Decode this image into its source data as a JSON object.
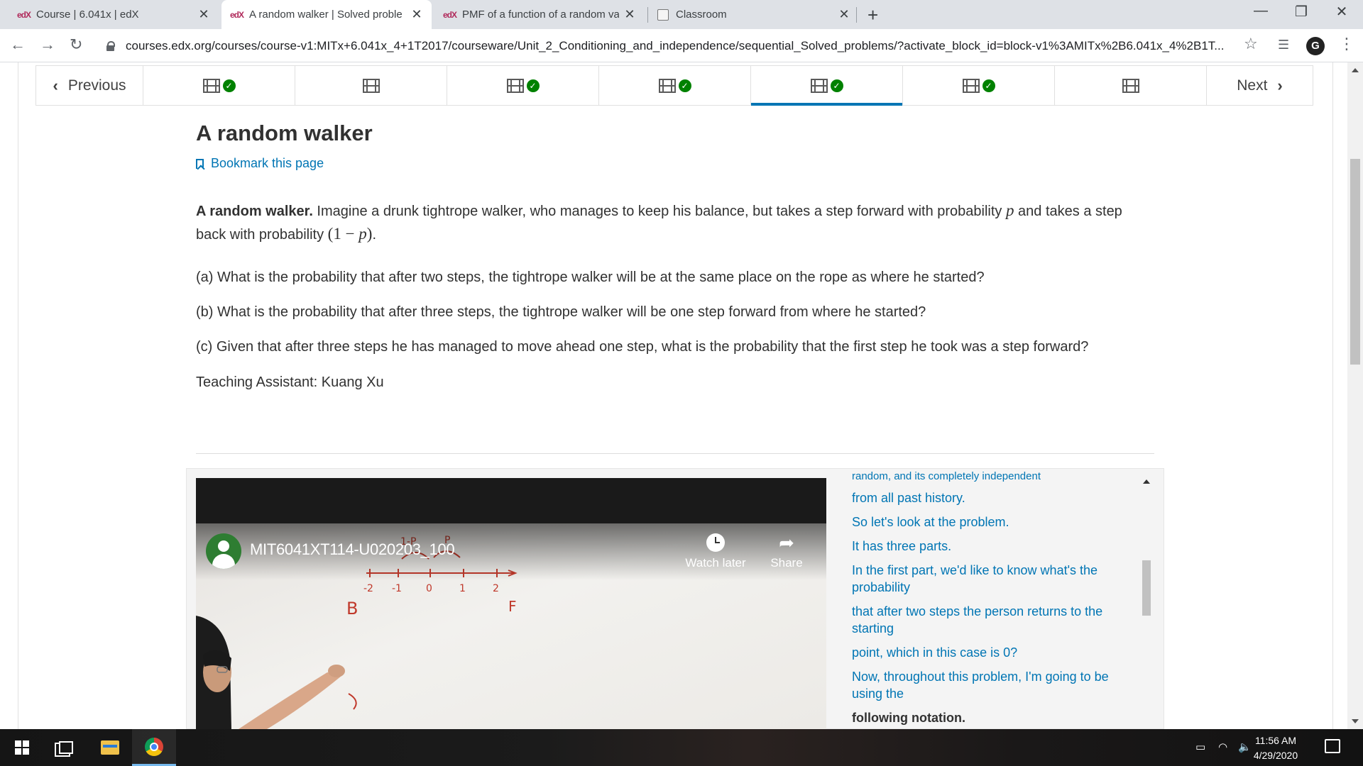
{
  "browser": {
    "tabs": [
      {
        "favicon": "edX",
        "title": "Course | 6.041x | edX",
        "active": false
      },
      {
        "favicon": "edX",
        "title": "A random walker | Solved proble",
        "active": true
      },
      {
        "favicon": "edX",
        "title": "PMF of a function of a random va",
        "active": false
      },
      {
        "favicon": "classroom-icon",
        "title": "Classroom",
        "active": false
      }
    ],
    "url": "courses.edx.org/courses/course-v1:MITx+6.041x_4+1T2017/courseware/Unit_2_Conditioning_and_independence/sequential_Solved_problems/?activate_block_id=block-v1%3AMITx%2B6.041x_4%2B1T..."
  },
  "sequence_nav": {
    "previous_label": "Previous",
    "next_label": "Next",
    "items": [
      {
        "type": "video",
        "completed": true,
        "active": false
      },
      {
        "type": "video",
        "completed": false,
        "active": false
      },
      {
        "type": "video",
        "completed": true,
        "active": false
      },
      {
        "type": "video",
        "completed": true,
        "active": false
      },
      {
        "type": "video",
        "completed": true,
        "active": true
      },
      {
        "type": "video",
        "completed": true,
        "active": false
      },
      {
        "type": "video",
        "completed": false,
        "active": false
      }
    ]
  },
  "unit": {
    "title": "A random walker",
    "bookmark_label": "Bookmark this page",
    "intro_bold": "A random walker.",
    "intro_text_1": " Imagine a drunk tightrope walker, who manages to keep his balance, but takes a step forward with probability ",
    "intro_text_2": " and takes a step back with probability ",
    "intro_text_3": ".",
    "question_a": "(a) What is the probability that after two steps, the tightrope walker will be at the same place on the rope as where he started?",
    "question_b": "(b) What is the probability that after three steps, the tightrope walker will be one step forward from where he started?",
    "question_c": "(c) Given that after three steps he has managed to move ahead one step, what is the probability that the first step he took was a step forward?",
    "ta": "Teaching Assistant: Kuang Xu"
  },
  "video": {
    "title": "MIT6041XT114-U020203_100",
    "watch_later_label": "Watch later",
    "share_label": "Share"
  },
  "transcript": {
    "partial_line": "random, and its completely independent",
    "lines": [
      "from all past history.",
      "So let's look at the problem.",
      "It has three parts.",
      "In the first part, we'd like to know what's the probability",
      "that after two steps the person returns to the starting",
      "point, which in this case is 0?",
      "Now, throughout this problem, I'm going to be using the"
    ],
    "current_line": "following notation."
  },
  "taskbar": {
    "time": "11:56 AM",
    "date": "4/29/2020"
  },
  "colors": {
    "link_blue": "#0075b4",
    "check_green": "#008100"
  }
}
